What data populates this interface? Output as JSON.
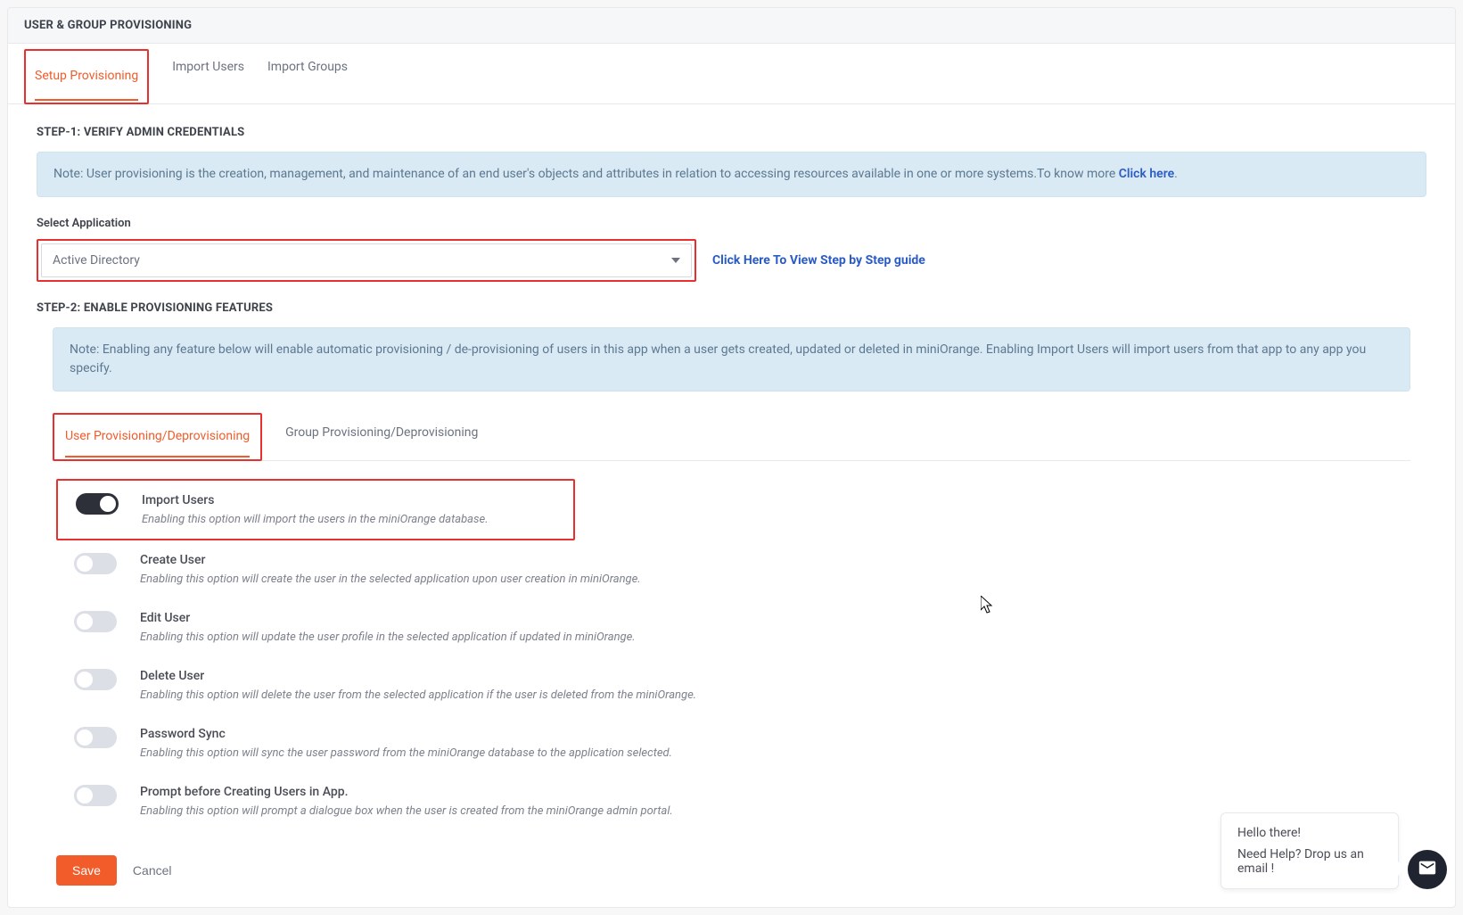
{
  "header": {
    "title": "USER & GROUP PROVISIONING"
  },
  "tabs": [
    {
      "label": "Setup Provisioning",
      "highlight": true,
      "active": true
    },
    {
      "label": "Import Users"
    },
    {
      "label": "Import Groups"
    }
  ],
  "step1": {
    "title": "STEP-1: VERIFY ADMIN CREDENTIALS",
    "note_prefix": "Note: User provisioning is the creation, management, and maintenance of an end user's objects and attributes in relation to accessing resources available in one or more systems.To know more ",
    "note_link": "Click here",
    "note_suffix": ".",
    "select_label": "Select Application",
    "select_value": "Active Directory",
    "guide_link": "Click Here To View Step by Step guide"
  },
  "step2": {
    "title": "STEP-2: ENABLE PROVISIONING FEATURES",
    "note": "Note: Enabling any feature below will enable automatic provisioning / de-provisioning of users in this app when a user gets created, updated or deleted in miniOrange. Enabling Import Users will import users from that app to any app you specify."
  },
  "subtabs": [
    {
      "label": "User Provisioning/Deprovisioning",
      "highlight": true,
      "active": true
    },
    {
      "label": "Group Provisioning/Deprovisioning"
    }
  ],
  "features": [
    {
      "title": "Import Users",
      "desc": "Enabling this option will import the users in the miniOrange database.",
      "on": true,
      "highlight": true
    },
    {
      "title": "Create User",
      "desc": "Enabling this option will create the user in the selected application upon user creation in miniOrange.",
      "on": false
    },
    {
      "title": "Edit User",
      "desc": "Enabling this option will update the user profile in the selected application if updated in miniOrange.",
      "on": false
    },
    {
      "title": "Delete User",
      "desc": "Enabling this option will delete the user from the selected application if the user is deleted from the miniOrange.",
      "on": false
    },
    {
      "title": "Password Sync",
      "desc": "Enabling this option will sync the user password from the miniOrange database to the application selected.",
      "on": false
    },
    {
      "title": "Prompt before Creating Users in App.",
      "desc": "Enabling this option will prompt a dialogue box when the user is created from the miniOrange admin portal.",
      "on": false
    }
  ],
  "actions": {
    "save": "Save",
    "cancel": "Cancel"
  },
  "help": {
    "line1": "Hello there!",
    "line2": "Need Help? Drop us an email !"
  }
}
